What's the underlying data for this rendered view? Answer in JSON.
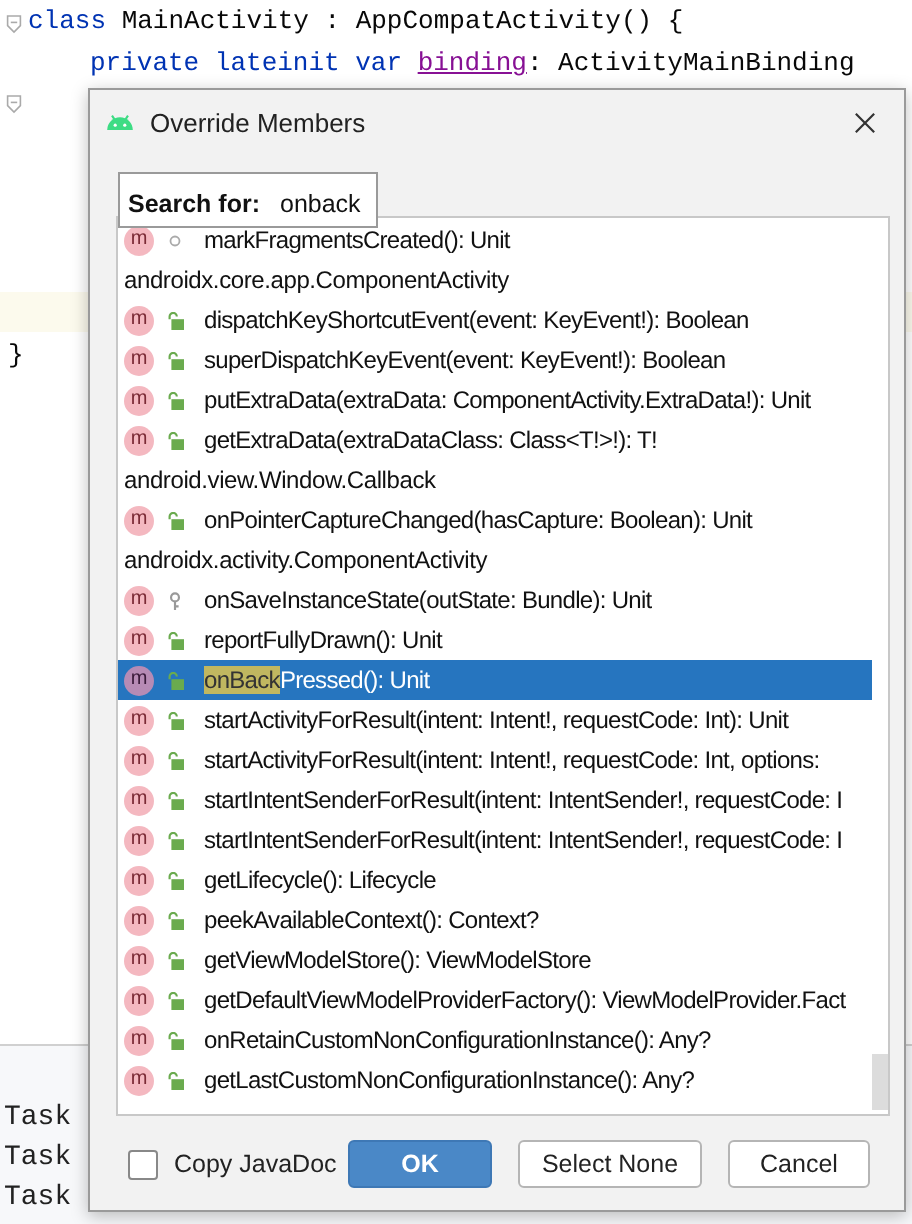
{
  "editor": {
    "lines": [
      {
        "indent": false,
        "tokens": [
          {
            "kind": "keyword",
            "text": "class"
          },
          {
            "kind": "plain",
            "text": "MainActivity : AppCompatActivity() {"
          }
        ]
      },
      {
        "indent": true,
        "tokens": [
          {
            "kind": "keyword",
            "text": "private lateinit var"
          },
          {
            "kind": "property",
            "text": "binding"
          },
          {
            "kind": "plain",
            "text": ": ActivityMainBinding"
          }
        ]
      }
    ],
    "closing_brace": "}"
  },
  "console": {
    "lines": [
      "Task",
      "Task",
      "Task"
    ]
  },
  "dialog": {
    "title": "Override Members",
    "search": {
      "label": "Search for:",
      "value": "onback"
    },
    "rows": [
      {
        "kind": "internal",
        "badge": "m",
        "selected": false,
        "text": "markFragmentsCreated(): Unit"
      },
      {
        "kind": "group",
        "text": "androidx.core.app.ComponentActivity"
      },
      {
        "kind": "public",
        "badge": "m",
        "selected": false,
        "text": "dispatchKeyShortcutEvent(event: KeyEvent!): Boolean"
      },
      {
        "kind": "public",
        "badge": "m",
        "selected": false,
        "text": "superDispatchKeyEvent(event: KeyEvent!): Boolean"
      },
      {
        "kind": "public",
        "badge": "m",
        "selected": false,
        "text": "putExtraData(extraData: ComponentActivity.ExtraData!): Unit"
      },
      {
        "kind": "public",
        "badge": "m",
        "selected": false,
        "text": "getExtraData(extraDataClass: Class<T!>!): T!"
      },
      {
        "kind": "group",
        "text": "android.view.Window.Callback"
      },
      {
        "kind": "public",
        "badge": "m",
        "selected": false,
        "text": "onPointerCaptureChanged(hasCapture: Boolean): Unit"
      },
      {
        "kind": "group",
        "text": "androidx.activity.ComponentActivity"
      },
      {
        "kind": "protected",
        "badge": "m",
        "selected": false,
        "text": "onSaveInstanceState(outState: Bundle): Unit"
      },
      {
        "kind": "public",
        "badge": "m",
        "selected": false,
        "text": "reportFullyDrawn(): Unit"
      },
      {
        "kind": "public",
        "badge": "m",
        "selected": true,
        "match": "onBack",
        "text": "Pressed(): Unit"
      },
      {
        "kind": "public",
        "badge": "m",
        "selected": false,
        "text": "startActivityForResult(intent: Intent!, requestCode: Int): Unit"
      },
      {
        "kind": "public",
        "badge": "m",
        "selected": false,
        "text": "startActivityForResult(intent: Intent!, requestCode: Int, options:"
      },
      {
        "kind": "public",
        "badge": "m",
        "selected": false,
        "text": "startIntentSenderForResult(intent: IntentSender!, requestCode: I"
      },
      {
        "kind": "public",
        "badge": "m",
        "selected": false,
        "text": "startIntentSenderForResult(intent: IntentSender!, requestCode: I"
      },
      {
        "kind": "public",
        "badge": "m",
        "selected": false,
        "text": "getLifecycle(): Lifecycle"
      },
      {
        "kind": "public",
        "badge": "m",
        "selected": false,
        "text": "peekAvailableContext(): Context?"
      },
      {
        "kind": "public",
        "badge": "m",
        "selected": false,
        "text": "getViewModelStore(): ViewModelStore"
      },
      {
        "kind": "public",
        "badge": "m",
        "selected": false,
        "text": "getDefaultViewModelProviderFactory(): ViewModelProvider.Fact"
      },
      {
        "kind": "public",
        "badge": "m",
        "selected": false,
        "text": "onRetainCustomNonConfigurationInstance(): Any?"
      },
      {
        "kind": "public",
        "badge": "m",
        "selected": false,
        "text": "getLastCustomNonConfigurationInstance(): Any?"
      }
    ],
    "copy_javadoc": {
      "label": "Copy JavaDoc",
      "checked": false
    },
    "buttons": [
      {
        "label": "OK",
        "primary": true
      },
      {
        "label": "Select None",
        "primary": false
      },
      {
        "label": "Cancel",
        "primary": false
      }
    ]
  }
}
